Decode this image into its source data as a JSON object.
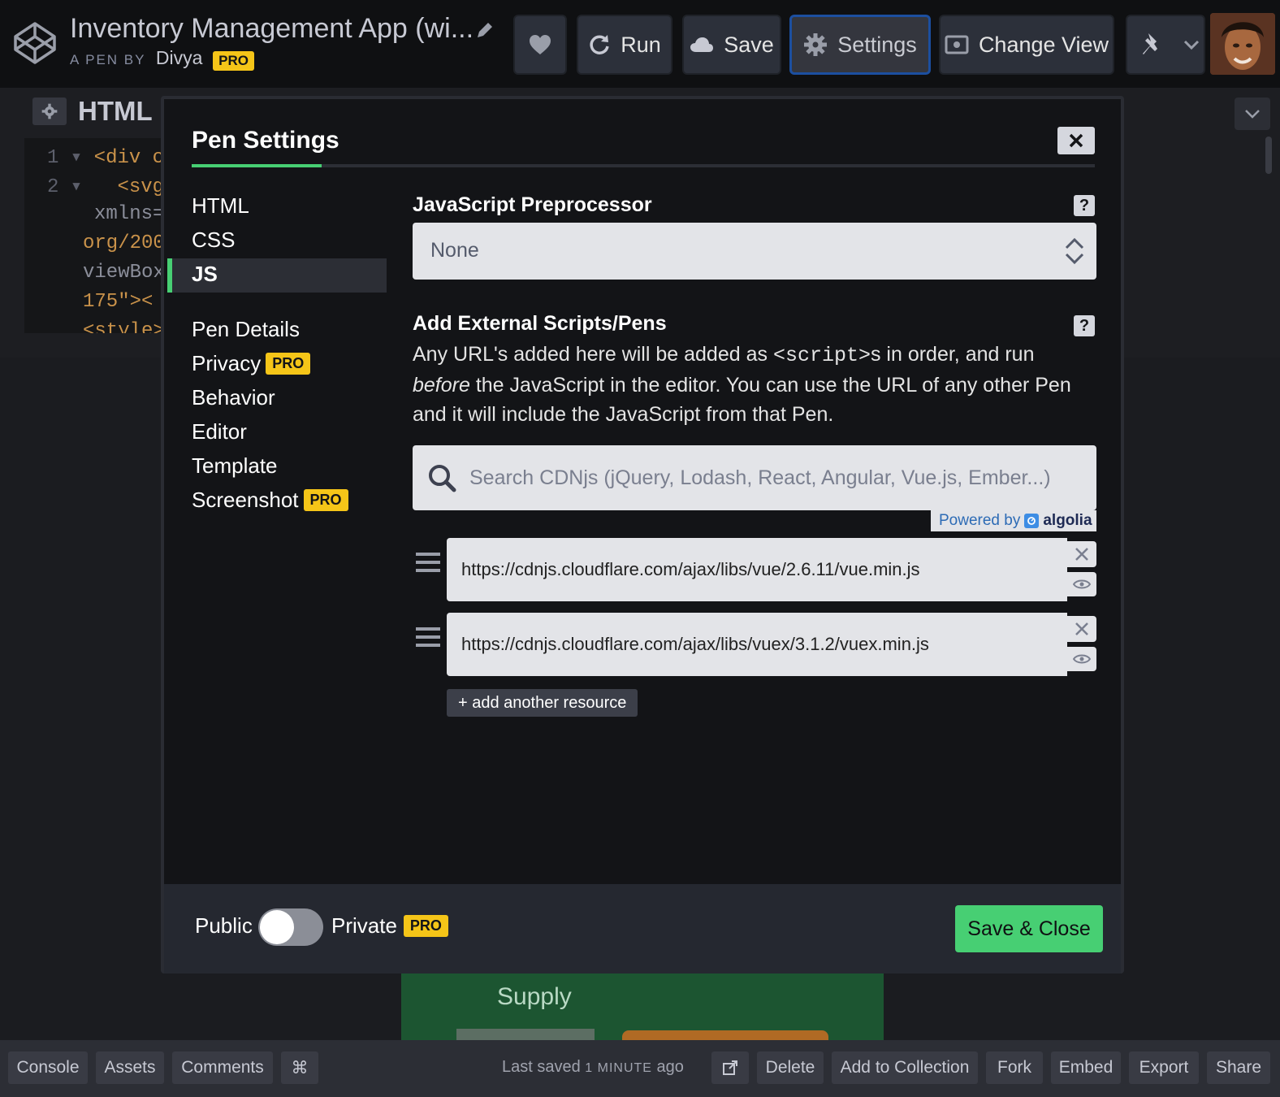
{
  "header": {
    "title": "Inventory Management App (wi...",
    "by_prefix": "A PEN BY",
    "author": "Divya",
    "author_badge": "PRO",
    "run_label": "Run",
    "save_label": "Save",
    "settings_label": "Settings",
    "change_view_label": "Change View"
  },
  "editor": {
    "tab_label": "HTML",
    "lines": [
      {
        "num": "1",
        "text": "<div cl"
      },
      {
        "num": "2",
        "text": "<svg"
      },
      {
        "num": "",
        "text": "xmlns="
      },
      {
        "num": "",
        "text": "org/200"
      },
      {
        "num": "",
        "text": "viewBox"
      },
      {
        "num": "",
        "text": "175\"><"
      },
      {
        "num": "",
        "text": "<style>"
      }
    ]
  },
  "preview": {
    "supply_label": "Supply"
  },
  "modal": {
    "title": "Pen Settings",
    "nav": [
      {
        "label": "HTML",
        "badge": ""
      },
      {
        "label": "CSS",
        "badge": ""
      },
      {
        "label": "JS",
        "badge": ""
      },
      {
        "label": "Pen Details",
        "badge": ""
      },
      {
        "label": "Privacy",
        "badge": "PRO"
      },
      {
        "label": "Behavior",
        "badge": ""
      },
      {
        "label": "Editor",
        "badge": ""
      },
      {
        "label": "Template",
        "badge": ""
      },
      {
        "label": "Screenshot",
        "badge": "PRO"
      }
    ],
    "active_nav": "JS",
    "js_preprocessor": {
      "title": "JavaScript Preprocessor",
      "selected": "None",
      "help": "?"
    },
    "external": {
      "title": "Add External Scripts/Pens",
      "help": "?",
      "desc_part1": "Any URL's added here will be added as ",
      "desc_code": "<script>",
      "desc_part2": "s in order, and run ",
      "desc_em": "before",
      "desc_part3": " the JavaScript in the editor. You can use the URL of any other Pen and it will include the JavaScript from that Pen.",
      "search_placeholder": "Search CDNjs (jQuery, Lodash, React, Angular, Vue.js, Ember...)",
      "powered_by": "Powered by",
      "powered_brand": "algolia",
      "resources": [
        "https://cdnjs.cloudflare.com/ajax/libs/vue/2.6.11/vue.min.js",
        "https://cdnjs.cloudflare.com/ajax/libs/vuex/3.1.2/vuex.min.js"
      ],
      "add_resource_label": "+ add another resource"
    },
    "footer": {
      "public_label": "Public",
      "private_label": "Private",
      "private_badge": "PRO",
      "toggle_on": false,
      "save_close_label": "Save & Close"
    }
  },
  "bottom_bar": {
    "console": "Console",
    "assets": "Assets",
    "comments": "Comments",
    "shortcut": "⌘",
    "last_saved_prefix": "Last saved",
    "last_saved_time": "1 MINUTE",
    "last_saved_suffix": "ago",
    "delete": "Delete",
    "add_to_collection": "Add to Collection",
    "fork": "Fork",
    "embed": "Embed",
    "export": "Export",
    "share": "Share"
  },
  "colors": {
    "accent_green": "#47cf73",
    "pro_badge": "#f5c518",
    "settings_border": "#1c4fa0"
  }
}
